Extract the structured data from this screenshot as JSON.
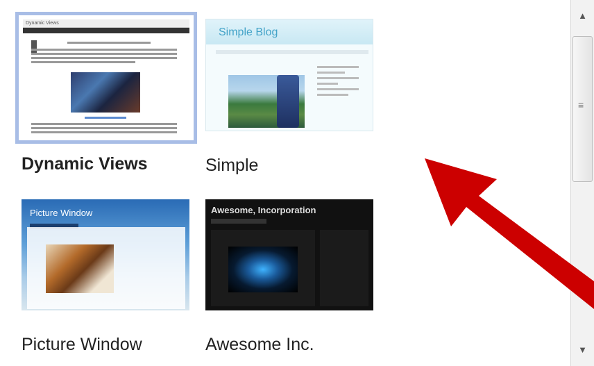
{
  "themes": [
    {
      "name": "Dynamic Views",
      "selected": true
    },
    {
      "name": "Simple",
      "selected": false
    },
    {
      "name": "Picture Window",
      "selected": false
    },
    {
      "name": "Awesome Inc.",
      "selected": false
    }
  ],
  "thumbnails": {
    "dynamic_views_title": "Dynamic Views",
    "simple_title": "Simple Blog",
    "picture_window_title": "Picture Window",
    "awesome_title": "Awesome, Incorporation"
  },
  "scrollbar": {
    "up_icon": "▲",
    "down_icon": "▼",
    "grip_icon": "≡"
  },
  "colors": {
    "selection_border": "#a8bde6",
    "arrow": "#cc0000"
  }
}
